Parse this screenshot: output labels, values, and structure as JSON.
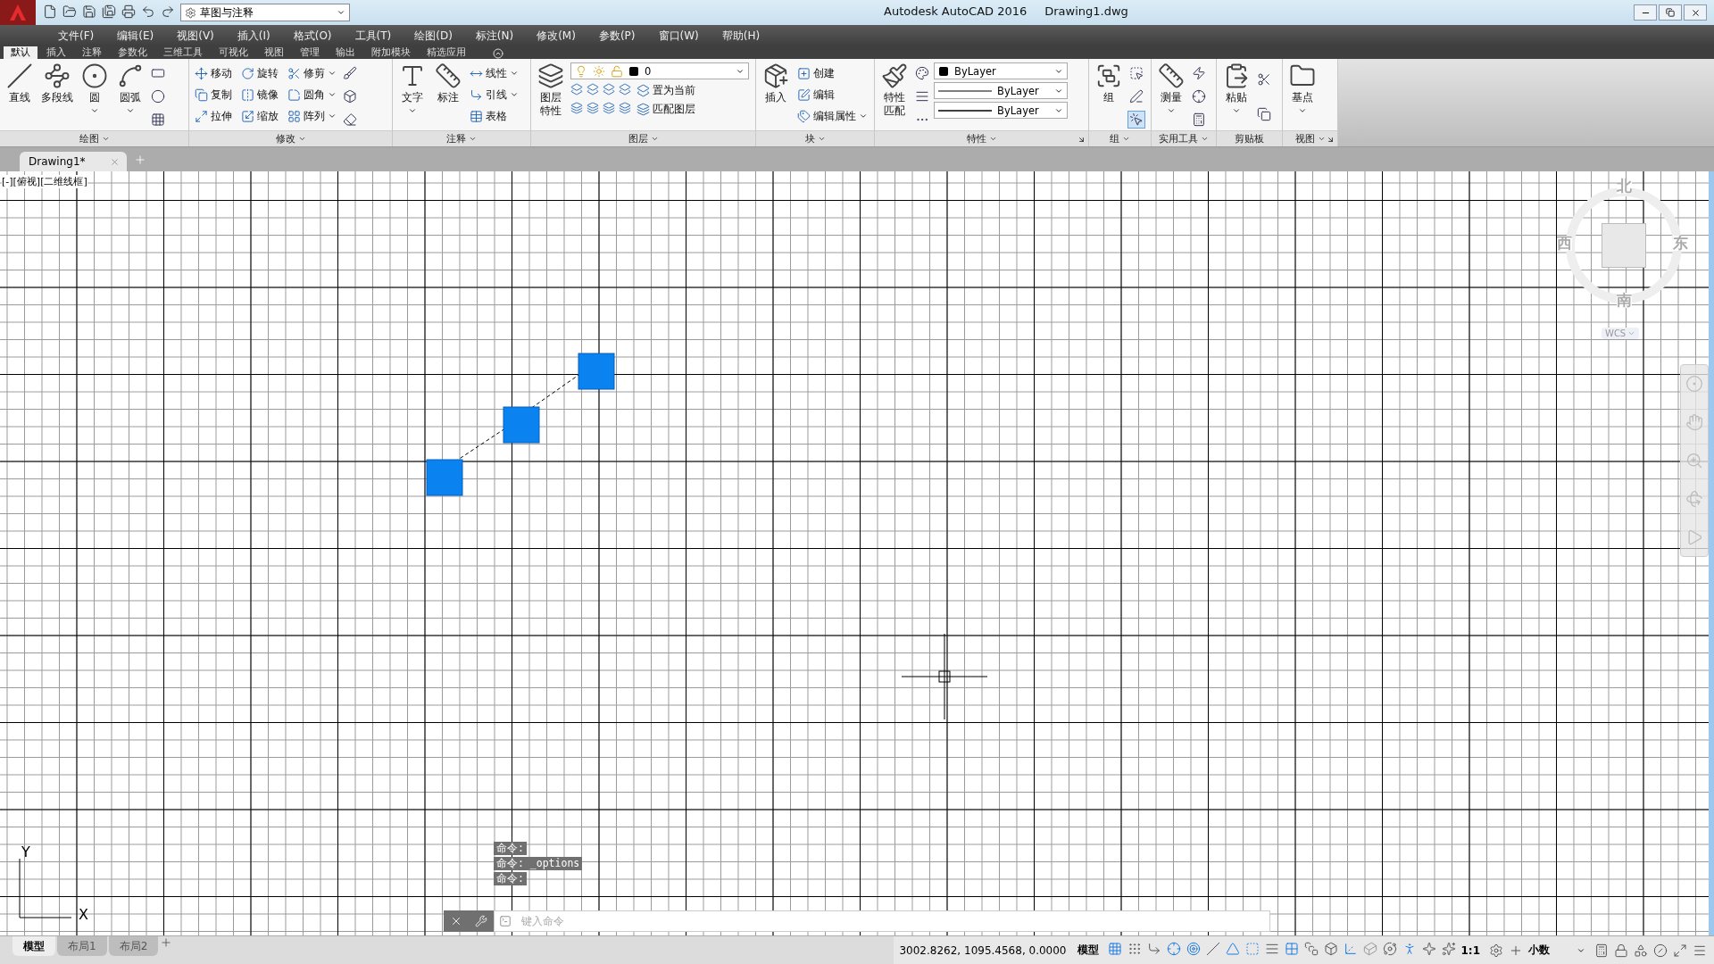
{
  "title_bar": {
    "workspace": "草图与注释",
    "title": "Autodesk AutoCAD 2016",
    "file": "Drawing1.dwg"
  },
  "menu": [
    "文件(F)",
    "编辑(E)",
    "视图(V)",
    "插入(I)",
    "格式(O)",
    "工具(T)",
    "绘图(D)",
    "标注(N)",
    "修改(M)",
    "参数(P)",
    "窗口(W)",
    "帮助(H)"
  ],
  "ribbon_tabs": [
    {
      "label": "默认",
      "selected": true
    },
    {
      "label": "插入",
      "selected": false
    },
    {
      "label": "注释",
      "selected": false
    },
    {
      "label": "参数化",
      "selected": false
    },
    {
      "label": "三维工具",
      "selected": false
    },
    {
      "label": "可视化",
      "selected": false
    },
    {
      "label": "视图",
      "selected": false
    },
    {
      "label": "管理",
      "selected": false
    },
    {
      "label": "输出",
      "selected": false
    },
    {
      "label": "附加模块",
      "selected": false
    },
    {
      "label": "精选应用",
      "selected": false
    }
  ],
  "ribbon_panels": [
    {
      "title": "绘图",
      "menu": true,
      "large": [
        {
          "label": "直线",
          "dropdown": false
        },
        {
          "label": "多段线",
          "dropdown": false
        },
        {
          "label": "圆",
          "dropdown": true
        },
        {
          "label": "圆弧",
          "dropdown": true
        }
      ]
    },
    {
      "title": "修改",
      "menu": true,
      "small": [
        {
          "label": "移动",
          "dropdown": false
        },
        {
          "label": "旋转",
          "dropdown": false
        },
        {
          "label": "修剪",
          "dropdown": true
        },
        {
          "label": "复制",
          "dropdown": false
        },
        {
          "label": "镜像",
          "dropdown": false
        },
        {
          "label": "圆角",
          "dropdown": true
        },
        {
          "label": "拉伸",
          "dropdown": false
        },
        {
          "label": "缩放",
          "dropdown": false
        },
        {
          "label": "阵列",
          "dropdown": true
        }
      ]
    },
    {
      "title": "注释",
      "menu": true,
      "large": [
        {
          "label": "文字",
          "dropdown": true
        },
        {
          "label": "标注",
          "dropdown": false
        }
      ],
      "small": [
        {
          "label": "线性",
          "dropdown": true
        },
        {
          "label": "引线",
          "dropdown": true
        },
        {
          "label": "表格",
          "dropdown": false
        }
      ]
    },
    {
      "title": "图层",
      "menu": true,
      "large": [
        {
          "label": "图层特性",
          "dropdown": false
        }
      ],
      "layer": {
        "value": "0"
      },
      "small": [
        {
          "label": "置为当前",
          "dropdown": false
        },
        {
          "label": "匹配图层",
          "dropdown": false
        }
      ]
    },
    {
      "title": "块",
      "menu": true,
      "large": [
        {
          "label": "插入",
          "dropdown": false
        }
      ],
      "small": [
        {
          "label": "创建",
          "dropdown": false
        },
        {
          "label": "编辑",
          "dropdown": false
        },
        {
          "label": "编辑属性",
          "dropdown": true
        }
      ]
    },
    {
      "title": "特性",
      "menu": true,
      "launcher": true,
      "large": [
        {
          "label": "特性匹配",
          "dropdown": false
        }
      ],
      "properties": [
        {
          "kind": "color",
          "value": "ByLayer"
        },
        {
          "kind": "linetype",
          "value": "ByLayer"
        },
        {
          "kind": "lineweight",
          "value": "ByLayer"
        }
      ]
    },
    {
      "title": "组",
      "menu": true,
      "large": [
        {
          "label": "组",
          "dropdown": false
        }
      ]
    },
    {
      "title": "实用工具",
      "menu": true,
      "large": [
        {
          "label": "测量",
          "dropdown": true
        }
      ]
    },
    {
      "title": "剪贴板",
      "menu": false,
      "large": [
        {
          "label": "粘贴",
          "dropdown": true
        }
      ]
    },
    {
      "title": "视图",
      "menu": true,
      "launcher": true,
      "large": [
        {
          "label": "基点",
          "dropdown": true
        }
      ]
    }
  ],
  "document_tabs": [
    {
      "label": "Drawing1*",
      "selected": true
    }
  ],
  "viewport_label": "[-][俯视][二维线框]",
  "viewcube": {
    "north": "北",
    "south": "南",
    "west": "西",
    "east": "东",
    "ucs": "WCS"
  },
  "ucs_icon": {
    "x": "X",
    "y": "Y"
  },
  "command_history": [
    "命令:",
    "命令: _options",
    "命令:"
  ],
  "command_line": {
    "placeholder": "键入命令"
  },
  "layout_tabs": [
    {
      "label": "模型",
      "selected": true
    },
    {
      "label": "布局1",
      "selected": false
    },
    {
      "label": "布局2",
      "selected": false
    }
  ],
  "status_bar": {
    "coordinates": "3002.8262, 1095.4568, 0.0000",
    "space": "模型",
    "scale": "1:1",
    "units": "小数"
  }
}
